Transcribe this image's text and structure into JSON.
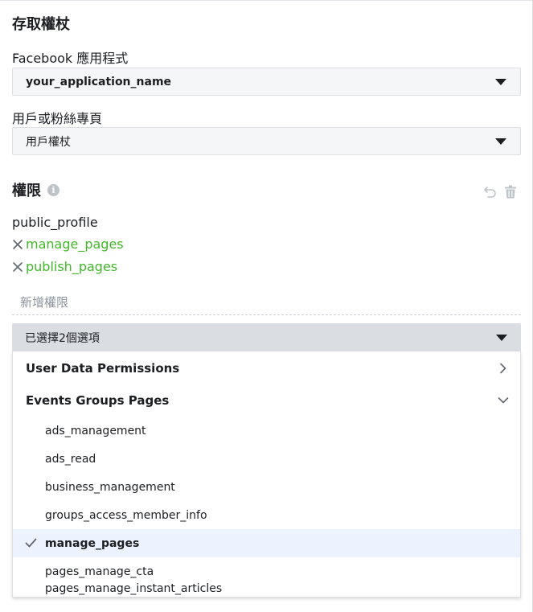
{
  "title": "存取權杖",
  "app_field": {
    "label": "Facebook 應用程式",
    "value": "your_application_name"
  },
  "page_field": {
    "label": "用戶或粉絲專頁",
    "value": "用戶權杖"
  },
  "permissions": {
    "heading": "權限",
    "info_glyph": "i",
    "items": [
      {
        "label": "public_profile",
        "removable": false
      },
      {
        "label": "manage_pages",
        "removable": true
      },
      {
        "label": "publish_pages",
        "removable": true
      }
    ],
    "add_placeholder": "新增權限",
    "selector_value": "已選擇2個選項",
    "accent_color": "#42b72a"
  },
  "dropdown": {
    "groups": [
      {
        "label": "User Data Permissions",
        "expanded": false
      },
      {
        "label": "Events Groups Pages",
        "expanded": true
      }
    ],
    "options": [
      {
        "label": "ads_management",
        "selected": false
      },
      {
        "label": "ads_read",
        "selected": false
      },
      {
        "label": "business_management",
        "selected": false
      },
      {
        "label": "groups_access_member_info",
        "selected": false
      },
      {
        "label": "manage_pages",
        "selected": true
      },
      {
        "label": "pages_manage_cta",
        "selected": false
      },
      {
        "label": "pages_manage_instant_articles",
        "selected": false
      }
    ]
  }
}
